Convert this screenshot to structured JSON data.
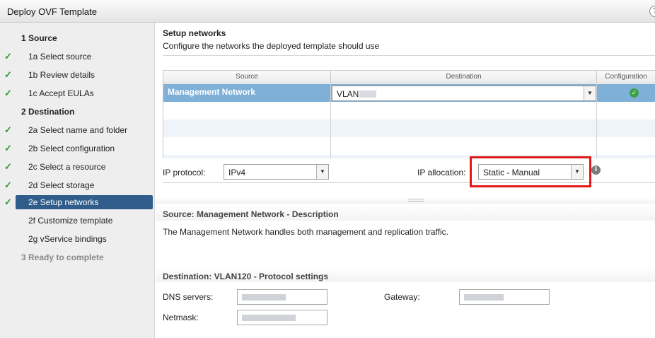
{
  "window": {
    "title": "Deploy OVF Template",
    "help_glyph": "?"
  },
  "steps": [
    {
      "label": "1  Source",
      "type": "group",
      "done": false,
      "active": false,
      "disabled": false
    },
    {
      "label": "1a  Select source",
      "type": "sub",
      "done": true,
      "active": false,
      "disabled": false
    },
    {
      "label": "1b  Review details",
      "type": "sub",
      "done": true,
      "active": false,
      "disabled": false
    },
    {
      "label": "1c  Accept EULAs",
      "type": "sub",
      "done": true,
      "active": false,
      "disabled": false
    },
    {
      "label": "2  Destination",
      "type": "group",
      "done": false,
      "active": false,
      "disabled": false
    },
    {
      "label": "2a  Select name and folder",
      "type": "sub",
      "done": true,
      "active": false,
      "disabled": false
    },
    {
      "label": "2b  Select configuration",
      "type": "sub",
      "done": true,
      "active": false,
      "disabled": false
    },
    {
      "label": "2c  Select a resource",
      "type": "sub",
      "done": true,
      "active": false,
      "disabled": false
    },
    {
      "label": "2d  Select storage",
      "type": "sub",
      "done": true,
      "active": false,
      "disabled": false
    },
    {
      "label": "2e  Setup networks",
      "type": "sub",
      "done": true,
      "active": true,
      "disabled": false
    },
    {
      "label": "2f  Customize template",
      "type": "sub",
      "done": false,
      "active": false,
      "disabled": false
    },
    {
      "label": "2g  vService bindings",
      "type": "sub",
      "done": false,
      "active": false,
      "disabled": false
    },
    {
      "label": "3  Ready to complete",
      "type": "group",
      "done": false,
      "active": false,
      "disabled": true
    }
  ],
  "header": {
    "title": "Setup networks",
    "subtitle": "Configure the networks the deployed template should use"
  },
  "table": {
    "columns": [
      "Source",
      "Destination",
      "Configuration"
    ],
    "rows": [
      {
        "source": "Management Network",
        "destination": "VLAN"
      }
    ]
  },
  "ip": {
    "protocol_label": "IP protocol:",
    "protocol_value": "IPv4",
    "allocation_label": "IP allocation:",
    "allocation_value": "Static - Manual"
  },
  "description": {
    "title": "Source: Management Network - Description",
    "text": "The Management Network handles both management and replication traffic."
  },
  "protocol_settings": {
    "title": "Destination: VLAN120 - Protocol settings",
    "dns_label": "DNS servers:",
    "gateway_label": "Gateway:",
    "netmask_label": "Netmask:"
  },
  "colors": {
    "active_step": "#2f5c8a",
    "selected_row": "#7fb0d8",
    "highlight_box": "#e01818",
    "check": "#2d9a2d"
  },
  "icons": {
    "check": "check-icon",
    "ok": "ok-status-icon",
    "info": "info-icon",
    "dropdown": "chevron-down-icon",
    "help": "help-icon"
  }
}
